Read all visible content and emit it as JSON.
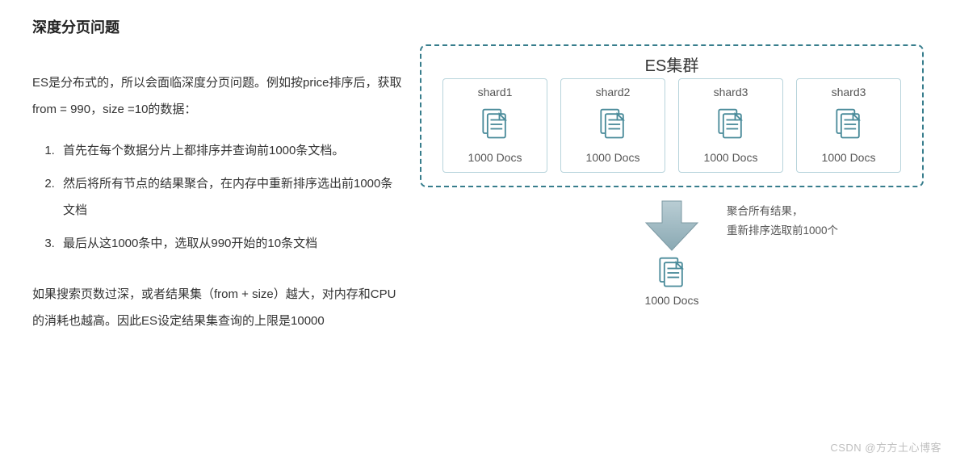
{
  "title": "深度分页问题",
  "intro": "ES是分布式的，所以会面临深度分页问题。例如按price排序后，获取from = 990，size =10的数据：",
  "steps": [
    "首先在每个数据分片上都排序并查询前1000条文档。",
    "然后将所有节点的结果聚合，在内存中重新排序选出前1000条文档",
    "最后从这1000条中，选取从990开始的10条文档"
  ],
  "note": "如果搜索页数过深，或者结果集（from + size）越大，对内存和CPU的消耗也越高。因此ES设定结果集查询的上限是10000",
  "cluster": {
    "title": "ES集群",
    "shards": [
      {
        "name": "shard1",
        "docs": "1000 Docs"
      },
      {
        "name": "shard2",
        "docs": "1000 Docs"
      },
      {
        "name": "shard3",
        "docs": "1000 Docs"
      },
      {
        "name": "shard3",
        "docs": "1000 Docs"
      }
    ]
  },
  "arrowLabel": {
    "line1": "聚合所有结果，",
    "line2": "重新排序选取前1000个"
  },
  "result": {
    "docs": "1000 Docs"
  },
  "colors": {
    "accent": "#4a8b9a",
    "dashed": "#377d8c"
  },
  "watermark": "CSDN @方方土心博客"
}
